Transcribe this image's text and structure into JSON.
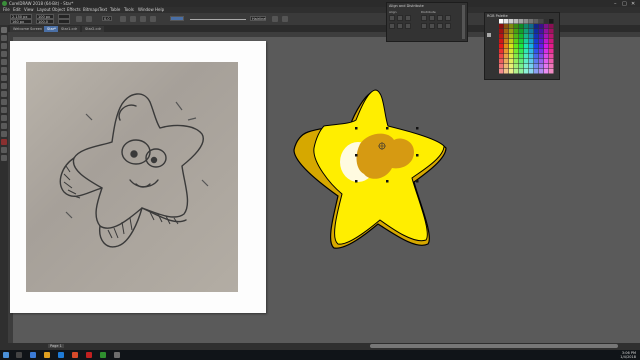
{
  "window": {
    "title": "CorelDRAW 2018 (64-Bit) - Star*",
    "minimize": "–",
    "maximize": "□",
    "close": "✕"
  },
  "menu": [
    "File",
    "Edit",
    "View",
    "Layout",
    "Object",
    "Effects",
    "Bitmaps",
    "Text",
    "Table",
    "Tools",
    "Window",
    "Help"
  ],
  "property_bar": {
    "x": "2.150 px",
    "y": "160 px",
    "w": "100 px",
    "h": "100.0",
    "angle": "0.0",
    "outline": "Hairline"
  },
  "tabs": [
    {
      "label": "Welcome Screen",
      "active": false
    },
    {
      "label": "Star*",
      "active": true
    },
    {
      "label": "Star1.cdr",
      "active": false
    },
    {
      "label": "Star2.cdr",
      "active": false
    }
  ],
  "docker_align": {
    "title": "Align and Distribute",
    "sections": [
      "Align",
      "Distribute"
    ]
  },
  "docker_palette": {
    "title": "RGB Palette"
  },
  "status": {
    "page_tab": "Page 1"
  },
  "taskbar": {
    "time": "3:06 PM",
    "date": "1/4/2018"
  },
  "colors": {
    "star_fill": "#ffee00",
    "star_shadow": "#d6a800",
    "cheek": "#d69a12",
    "accent": "#4a6fa5"
  }
}
